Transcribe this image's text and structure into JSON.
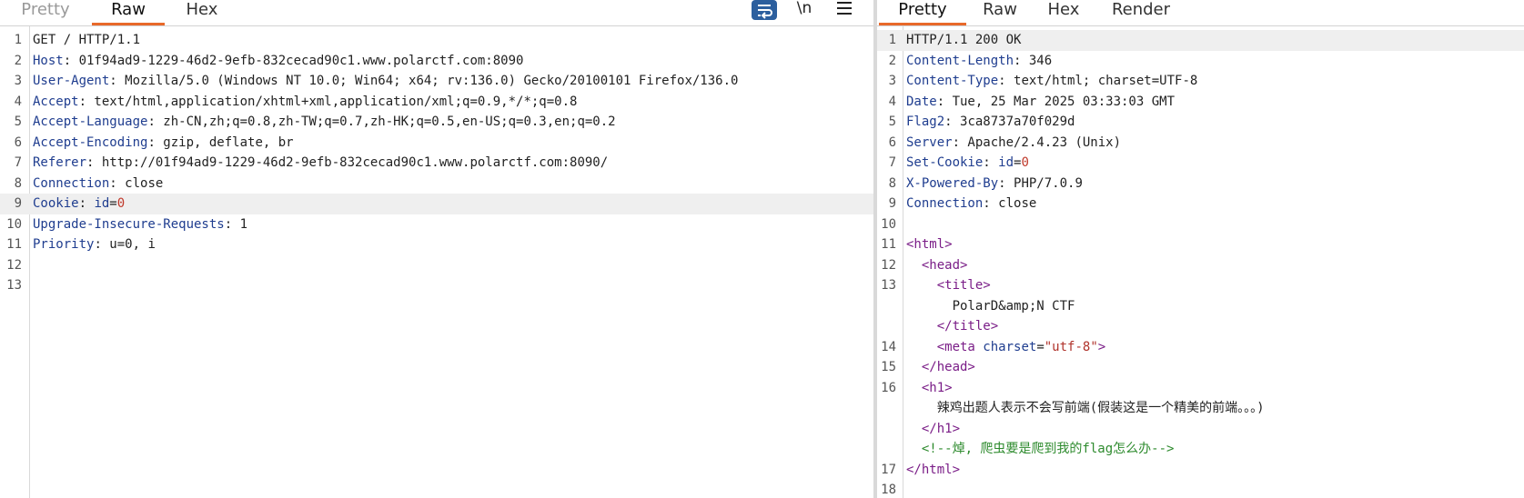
{
  "request": {
    "tabs": [
      "Pretty",
      "Raw",
      "Hex"
    ],
    "active_tab": "Raw",
    "toolbar": {
      "wrap_icon": "wrap-lines-icon",
      "newline_label": "\\n",
      "menu_icon": "hamburger-menu-icon"
    },
    "lines": [
      {
        "n": "1",
        "parts": [
          {
            "t": "GET / HTTP/1.1",
            "c": ""
          }
        ]
      },
      {
        "n": "2",
        "parts": [
          {
            "t": "Host",
            "c": "k"
          },
          {
            "t": ": 01f94ad9-1229-46d2-9efb-832cecad90c1.www.polarctf.com:8090",
            "c": ""
          }
        ]
      },
      {
        "n": "3",
        "parts": [
          {
            "t": "User-Agent",
            "c": "k"
          },
          {
            "t": ": Mozilla/5.0 (Windows NT 10.0; Win64; x64; rv:136.0) Gecko/20100101 Firefox/136.0",
            "c": ""
          }
        ]
      },
      {
        "n": "4",
        "parts": [
          {
            "t": "Accept",
            "c": "k"
          },
          {
            "t": ": text/html,application/xhtml+xml,application/xml;q=0.9,*/*;q=0.8",
            "c": ""
          }
        ]
      },
      {
        "n": "5",
        "parts": [
          {
            "t": "Accept-Language",
            "c": "k"
          },
          {
            "t": ": zh-CN,zh;q=0.8,zh-TW;q=0.7,zh-HK;q=0.5,en-US;q=0.3,en;q=0.2",
            "c": ""
          }
        ]
      },
      {
        "n": "6",
        "parts": [
          {
            "t": "Accept-Encoding",
            "c": "k"
          },
          {
            "t": ": gzip, deflate, br",
            "c": ""
          }
        ]
      },
      {
        "n": "7",
        "parts": [
          {
            "t": "Referer",
            "c": "k"
          },
          {
            "t": ": http://01f94ad9-1229-46d2-9efb-832cecad90c1.www.polarctf.com:8090/",
            "c": ""
          }
        ]
      },
      {
        "n": "8",
        "parts": [
          {
            "t": "Connection",
            "c": "k"
          },
          {
            "t": ": close",
            "c": ""
          }
        ]
      },
      {
        "n": "9",
        "hl": true,
        "parts": [
          {
            "t": "Cookie",
            "c": "k"
          },
          {
            "t": ": ",
            "c": ""
          },
          {
            "t": "id",
            "c": "k"
          },
          {
            "t": "=",
            "c": ""
          },
          {
            "t": "0",
            "c": "num"
          }
        ]
      },
      {
        "n": "10",
        "parts": [
          {
            "t": "Upgrade-Insecure-Requests",
            "c": "k"
          },
          {
            "t": ": 1",
            "c": ""
          }
        ]
      },
      {
        "n": "11",
        "parts": [
          {
            "t": "Priority",
            "c": "k"
          },
          {
            "t": ": u=0, i",
            "c": ""
          }
        ]
      },
      {
        "n": "12",
        "parts": []
      },
      {
        "n": "13",
        "parts": []
      }
    ]
  },
  "response": {
    "tabs": [
      "Pretty",
      "Raw",
      "Hex",
      "Render"
    ],
    "active_tab": "Pretty",
    "lines": [
      {
        "n": "1",
        "hl": true,
        "parts": [
          {
            "t": "HTTP/1.1 200 OK",
            "c": ""
          }
        ]
      },
      {
        "n": "2",
        "parts": [
          {
            "t": "Content-Length",
            "c": "k"
          },
          {
            "t": ": 346",
            "c": ""
          }
        ]
      },
      {
        "n": "3",
        "parts": [
          {
            "t": "Content-Type",
            "c": "k"
          },
          {
            "t": ": text/html; charset=UTF-8",
            "c": ""
          }
        ]
      },
      {
        "n": "4",
        "parts": [
          {
            "t": "Date",
            "c": "k"
          },
          {
            "t": ": Tue, 25 Mar 2025 03:33:03 GMT",
            "c": ""
          }
        ]
      },
      {
        "n": "5",
        "parts": [
          {
            "t": "Flag2",
            "c": "k"
          },
          {
            "t": ": 3ca8737a70f029d",
            "c": ""
          }
        ]
      },
      {
        "n": "6",
        "parts": [
          {
            "t": "Server",
            "c": "k"
          },
          {
            "t": ": Apache/2.4.23 (Unix)",
            "c": ""
          }
        ]
      },
      {
        "n": "7",
        "parts": [
          {
            "t": "Set-Cookie",
            "c": "k"
          },
          {
            "t": ": ",
            "c": ""
          },
          {
            "t": "id",
            "c": "k"
          },
          {
            "t": "=",
            "c": ""
          },
          {
            "t": "0",
            "c": "num"
          }
        ]
      },
      {
        "n": "8",
        "parts": [
          {
            "t": "X-Powered-By",
            "c": "k"
          },
          {
            "t": ": PHP/7.0.9",
            "c": ""
          }
        ]
      },
      {
        "n": "9",
        "parts": [
          {
            "t": "Connection",
            "c": "k"
          },
          {
            "t": ": close",
            "c": ""
          }
        ]
      },
      {
        "n": "10",
        "parts": []
      },
      {
        "n": "11",
        "parts": [
          {
            "t": "<html>",
            "c": "tag"
          }
        ]
      },
      {
        "n": "12",
        "parts": [
          {
            "t": "  ",
            "c": ""
          },
          {
            "t": "<head>",
            "c": "tag"
          }
        ]
      },
      {
        "n": "13",
        "parts": [
          {
            "t": "    ",
            "c": ""
          },
          {
            "t": "<title>",
            "c": "tag"
          }
        ]
      },
      {
        "n": "",
        "parts": [
          {
            "t": "      PolarD&amp;N CTF",
            "c": ""
          }
        ]
      },
      {
        "n": "",
        "parts": [
          {
            "t": "    ",
            "c": ""
          },
          {
            "t": "</title>",
            "c": "tag"
          }
        ]
      },
      {
        "n": "14",
        "parts": [
          {
            "t": "    ",
            "c": ""
          },
          {
            "t": "<meta ",
            "c": "tag"
          },
          {
            "t": "charset",
            "c": "attr"
          },
          {
            "t": "=",
            "c": ""
          },
          {
            "t": "\"utf-8\"",
            "c": "str"
          },
          {
            "t": ">",
            "c": "tag"
          }
        ]
      },
      {
        "n": "15",
        "parts": [
          {
            "t": "  ",
            "c": ""
          },
          {
            "t": "</head>",
            "c": "tag"
          }
        ]
      },
      {
        "n": "16",
        "parts": [
          {
            "t": "  ",
            "c": ""
          },
          {
            "t": "<h1>",
            "c": "tag"
          }
        ]
      },
      {
        "n": "",
        "parts": [
          {
            "t": "    辣鸡出题人表示不会写前端(假装这是一个精美的前端。。。)",
            "c": ""
          }
        ]
      },
      {
        "n": "",
        "parts": [
          {
            "t": "  ",
            "c": ""
          },
          {
            "t": "</h1>",
            "c": "tag"
          }
        ]
      },
      {
        "n": "",
        "parts": [
          {
            "t": "  ",
            "c": ""
          },
          {
            "t": "<!--焯, 爬虫要是爬到我的flag怎么办-->",
            "c": "cmt"
          }
        ]
      },
      {
        "n": "17",
        "parts": [
          {
            "t": "</html>",
            "c": "tag"
          }
        ]
      },
      {
        "n": "18",
        "parts": []
      }
    ]
  }
}
